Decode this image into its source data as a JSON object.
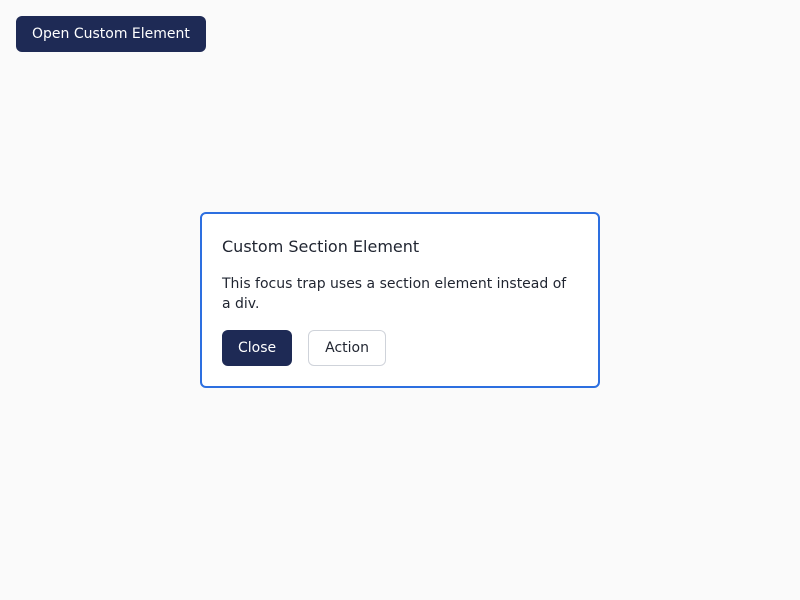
{
  "toolbar": {
    "open_label": "Open Custom Element"
  },
  "dialog": {
    "title": "Custom Section Element",
    "body": "This focus trap uses a section element instead of a div.",
    "close_label": "Close",
    "action_label": "Action"
  },
  "colors": {
    "background": "#fafafa",
    "primary": "#1e2a55",
    "focus_border": "#2d6fe0"
  }
}
